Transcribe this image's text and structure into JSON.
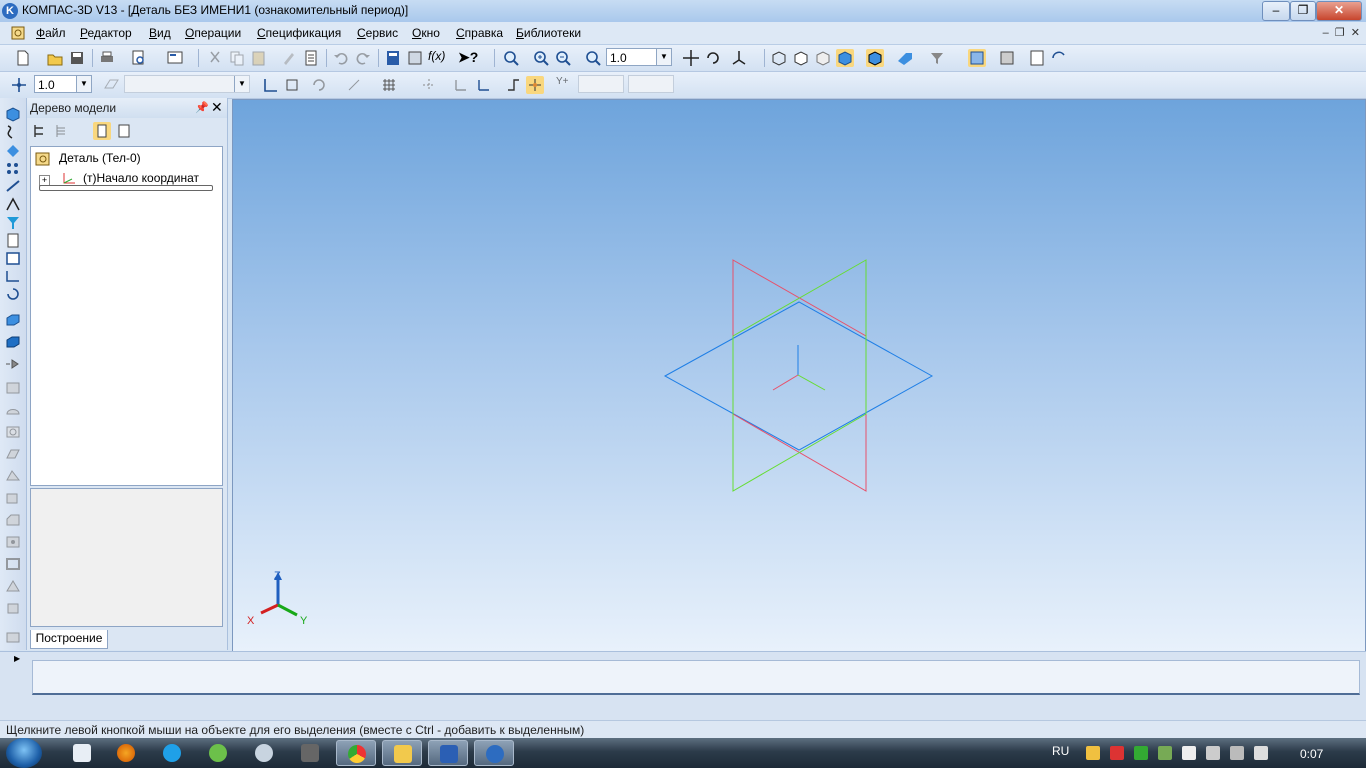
{
  "window": {
    "title": "КОМПАС-3D V13 - [Деталь БЕЗ ИМЕНИ1 (ознакомительный период)]",
    "app_icon_letter": "K"
  },
  "menu": {
    "items": [
      "Файл",
      "Редактор",
      "Вид",
      "Операции",
      "Спецификация",
      "Сервис",
      "Окно",
      "Справка",
      "Библиотеки"
    ]
  },
  "toolbar_main": {
    "zoom_value": "1.0"
  },
  "toolbar_second": {
    "step_value": "1.0"
  },
  "tree": {
    "title": "Дерево модели",
    "root_label": "Деталь (Тел-0)",
    "origin_label": "(т)Начало координат",
    "tab_label": "Построение"
  },
  "axis_labels": {
    "x": "X",
    "y": "Y",
    "z": "Z"
  },
  "status": {
    "text": "Щелкните левой кнопкой мыши на объекте для его выделения (вместе с Ctrl - добавить к выделенным)"
  },
  "taskbar": {
    "lang": "RU",
    "clock": "0:07"
  }
}
